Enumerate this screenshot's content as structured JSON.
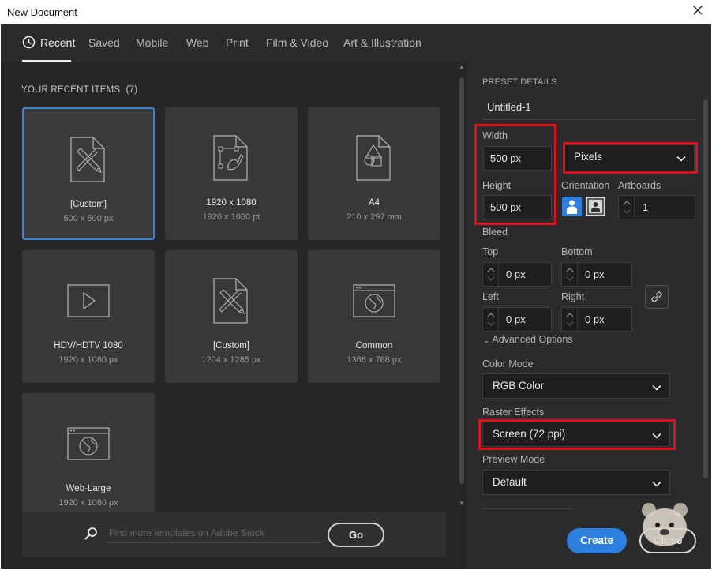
{
  "window": {
    "title": "New Document"
  },
  "tabs": [
    {
      "label": "Recent",
      "active": true
    },
    {
      "label": "Saved"
    },
    {
      "label": "Mobile"
    },
    {
      "label": "Web"
    },
    {
      "label": "Print"
    },
    {
      "label": "Film & Video"
    },
    {
      "label": "Art & Illustration"
    }
  ],
  "recent": {
    "heading": "YOUR RECENT ITEMS",
    "count": "(7)",
    "items": [
      {
        "name": "[Custom]",
        "dims": "500 x 500 px",
        "icon": "document-pencil-icon",
        "selected": true
      },
      {
        "name": "1920 x 1080",
        "dims": "1920 x 1080 pt",
        "icon": "artboard-pen-icon"
      },
      {
        "name": "A4",
        "dims": "210 x 297 mm",
        "icon": "document-shapes-icon"
      },
      {
        "name": "HDV/HDTV 1080",
        "dims": "1920 x 1080 px",
        "icon": "video-play-icon"
      },
      {
        "name": "[Custom]",
        "dims": "1204 x 1285 px",
        "icon": "document-pencil-icon"
      },
      {
        "name": "Common",
        "dims": "1366 x 768 px",
        "icon": "web-globe-icon"
      },
      {
        "name": "Web-Large",
        "dims": "1920 x 1080 px",
        "icon": "web-globe-icon"
      }
    ]
  },
  "stock": {
    "placeholder": "Find more templates on Adobe Stock",
    "go_label": "Go"
  },
  "preset": {
    "heading": "PRESET DETAILS",
    "name": "Untitled-1",
    "width_label": "Width",
    "width_value": "500 px",
    "height_label": "Height",
    "height_value": "500 px",
    "units": "Pixels",
    "orientation_label": "Orientation",
    "artboards_label": "Artboards",
    "artboards_value": "1",
    "bleed_label": "Bleed",
    "bleed": {
      "top_label": "Top",
      "top": "0 px",
      "bottom_label": "Bottom",
      "bottom": "0 px",
      "left_label": "Left",
      "left": "0 px",
      "right_label": "Right",
      "right": "0 px"
    },
    "advanced_label": "Advanced Options",
    "color_mode_label": "Color Mode",
    "color_mode": "RGB Color",
    "raster_label": "Raster Effects",
    "raster": "Screen (72 ppi)",
    "preview_label": "Preview Mode",
    "preview": "Default"
  },
  "actions": {
    "create": "Create",
    "close": "Close"
  },
  "colors": {
    "accent": "#2d7fe0",
    "highlight": "#e0101a",
    "selection": "#3b83d8"
  }
}
